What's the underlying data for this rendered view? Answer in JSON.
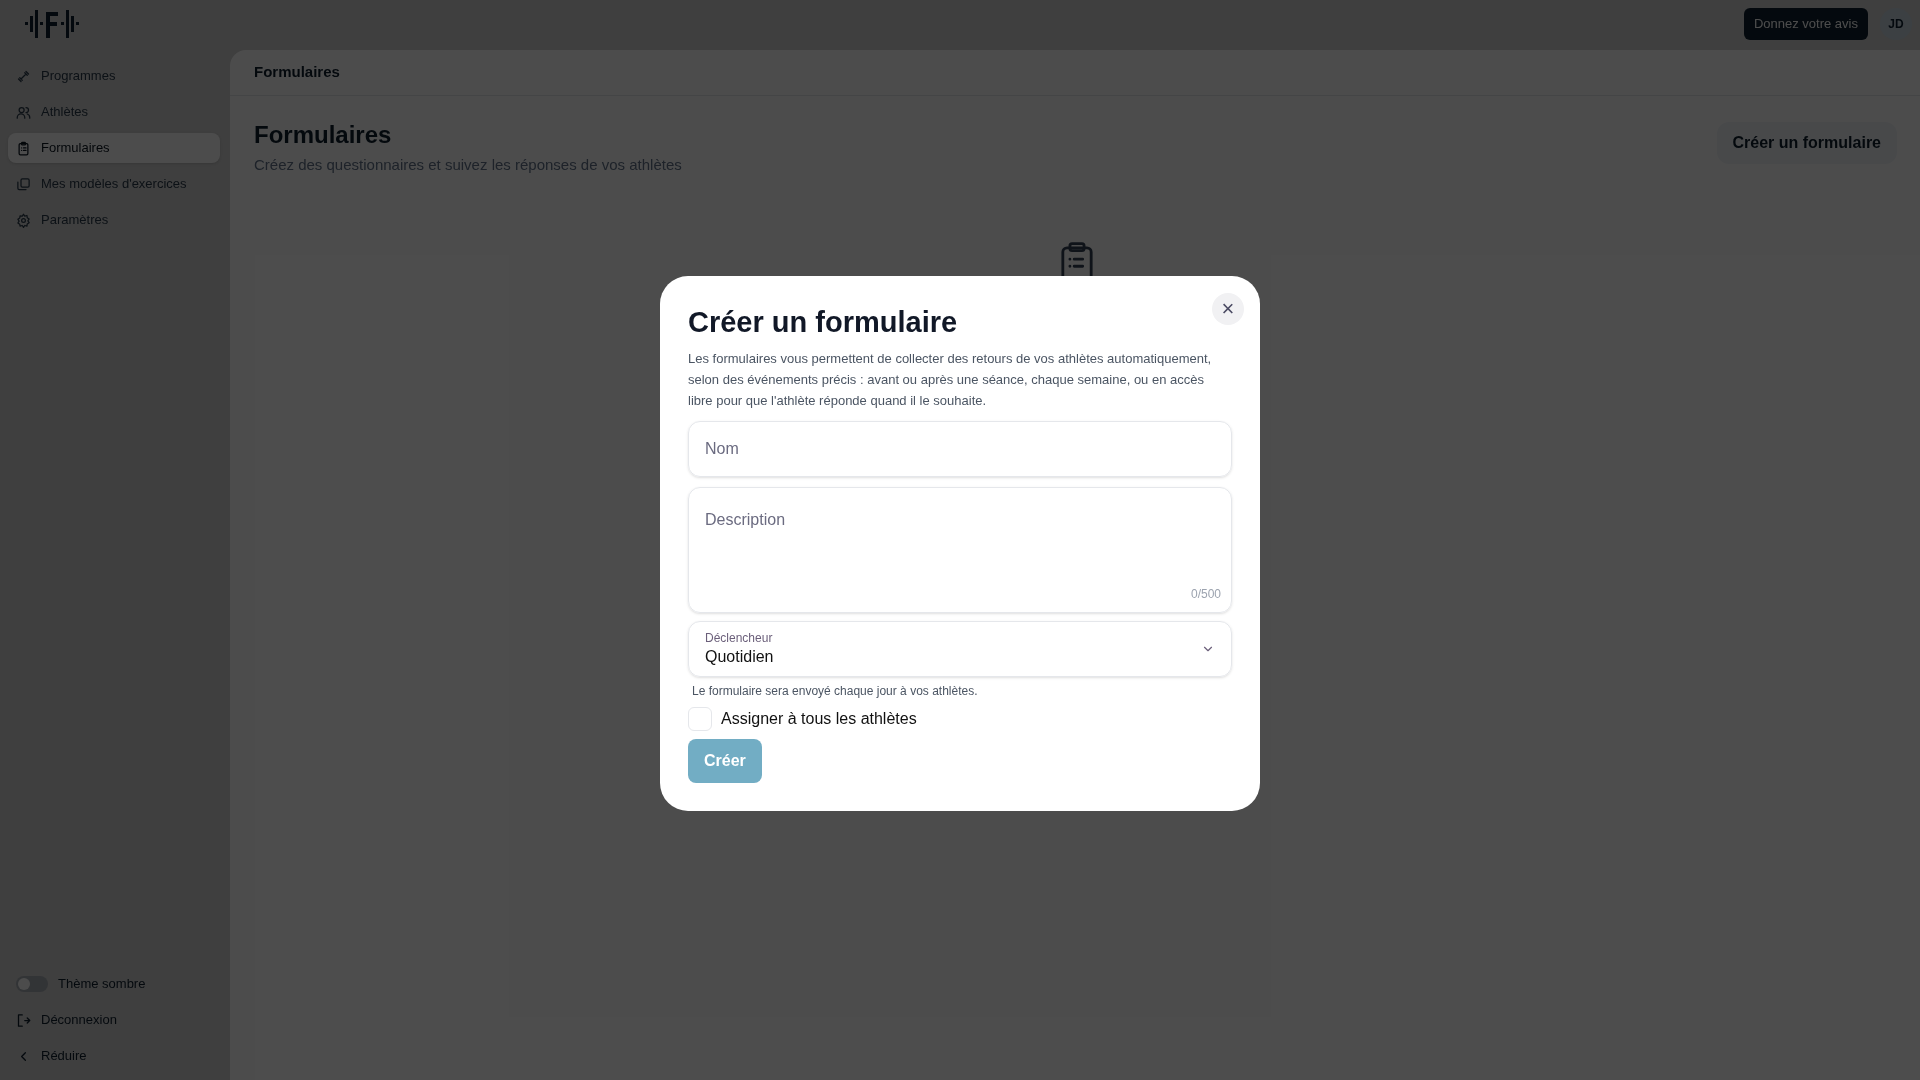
{
  "top_bar": {
    "feedback_button": "Donnez votre avis",
    "avatar": "JD"
  },
  "sidebar": {
    "items": [
      {
        "label": "Programmes",
        "selected": false
      },
      {
        "label": "Athlètes",
        "selected": false
      },
      {
        "label": "Formulaires",
        "selected": true
      },
      {
        "label": "Mes modèles d'exercices",
        "selected": false
      },
      {
        "label": "Paramètres",
        "selected": false
      }
    ],
    "footer": [
      {
        "kind": "toggle",
        "label": "Thème sombre",
        "on": false
      },
      {
        "kind": "link",
        "label": "Déconnexion"
      },
      {
        "kind": "link",
        "label": "Réduire"
      }
    ]
  },
  "breadcrumb": "Formulaires",
  "page": {
    "title": "Formulaires",
    "subtitle": "Créez des questionnaires et suivez les réponses de vos athlètes",
    "create_button": "Créer un formulaire"
  },
  "dialog": {
    "title": "Créer un formulaire",
    "close": "×",
    "description": "Les formulaires vous permettent de collecter des retours de vos athlètes automatiquement, selon des événements précis : avant ou après une séance, chaque semaine, ou en accès libre pour que l'athlète réponde quand il le souhaite.",
    "name_field": {
      "placeholder": "Nom"
    },
    "description_field": {
      "placeholder": "Description",
      "counter": "0/500"
    },
    "trigger": {
      "label": "Déclencheur",
      "value": "Quotidien",
      "helper": "Le formulaire sera envoyé chaque jour à vos athlètes."
    },
    "assign_all": {
      "label": "Assigner à tous les athlètes",
      "checked": false
    },
    "submit": {
      "label": "Créer",
      "disabled": true
    }
  }
}
